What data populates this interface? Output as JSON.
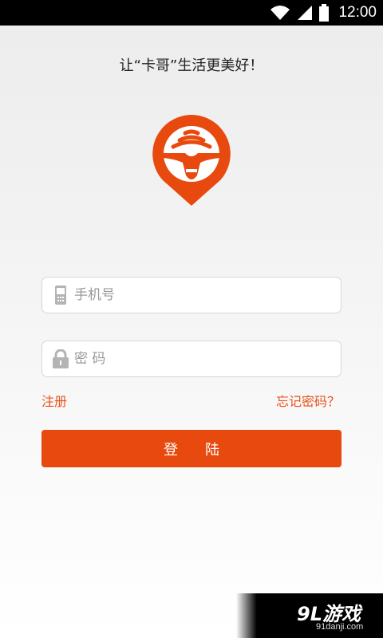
{
  "status_bar": {
    "time": "12:00",
    "icons": [
      "wifi-icon",
      "signal-icon",
      "battery-icon"
    ]
  },
  "tagline": "让“卡哥”生活更美好！",
  "logo": {
    "icon": "kage-pin-logo",
    "color": "#e8490f"
  },
  "form": {
    "phone": {
      "placeholder": "手机号",
      "value": "",
      "icon": "phone-icon"
    },
    "password": {
      "placeholder": "密 码",
      "value": "",
      "icon": "lock-icon"
    },
    "register_label": "注册",
    "forgot_label": "忘记密码？",
    "login_label": "登陆"
  },
  "watermark": {
    "main": "9L游戏",
    "sub": "91danji.com"
  },
  "colors": {
    "accent": "#e8490f",
    "link": "#e9521d",
    "background": "#f0f0f0"
  }
}
